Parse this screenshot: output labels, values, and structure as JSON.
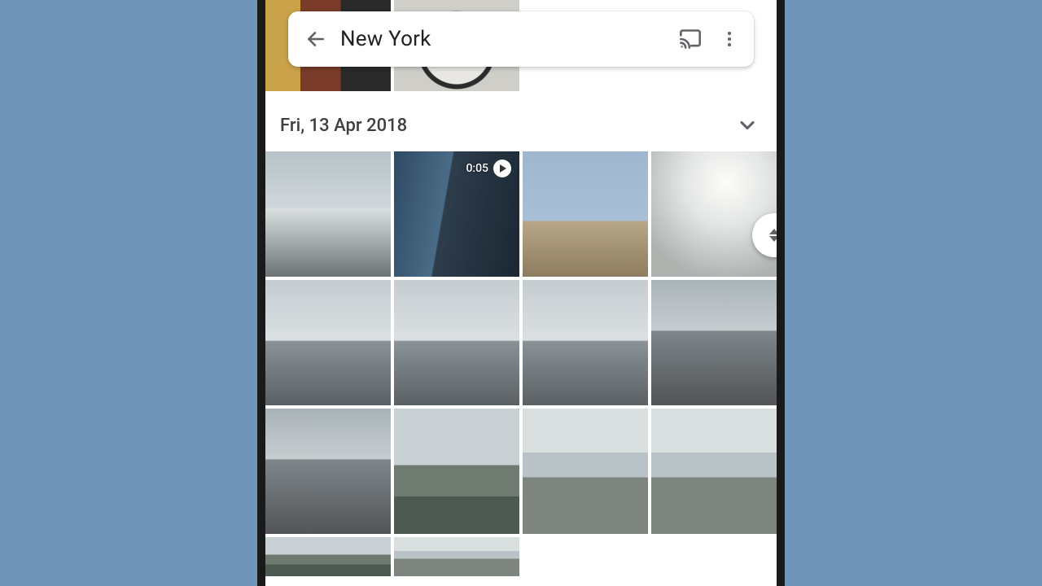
{
  "search": {
    "title": "New York"
  },
  "group": {
    "date": "Fri, 13 Apr 2018"
  },
  "video": {
    "duration": "0:05"
  }
}
